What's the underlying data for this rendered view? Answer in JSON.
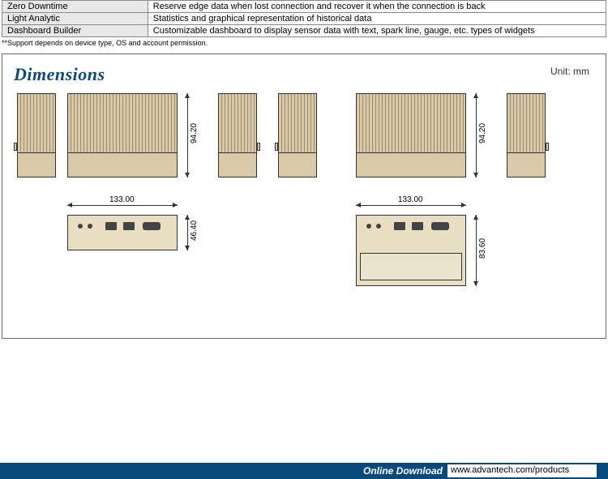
{
  "specs": [
    {
      "label": "Zero Downtime",
      "desc": "Reserve edge data when lost connection and recover it when the connection is back"
    },
    {
      "label": "Light Analytic",
      "desc": "Statistics and graphical representation of historical data"
    },
    {
      "label": "Dashboard Builder",
      "desc": "Customizable dashboard to display sensor data with text, spark line, gauge, etc. types of widgets"
    }
  ],
  "footnote": "**Support depends on device type, OS and account permission.",
  "dimensions": {
    "title": "Dimensions",
    "unit": "Unit: mm",
    "width": "133.00",
    "height": "94.20",
    "depth_a": "46.40",
    "depth_b": "83.60"
  },
  "footer": {
    "label": "Online Download",
    "url": "www.advantech.com/products"
  }
}
